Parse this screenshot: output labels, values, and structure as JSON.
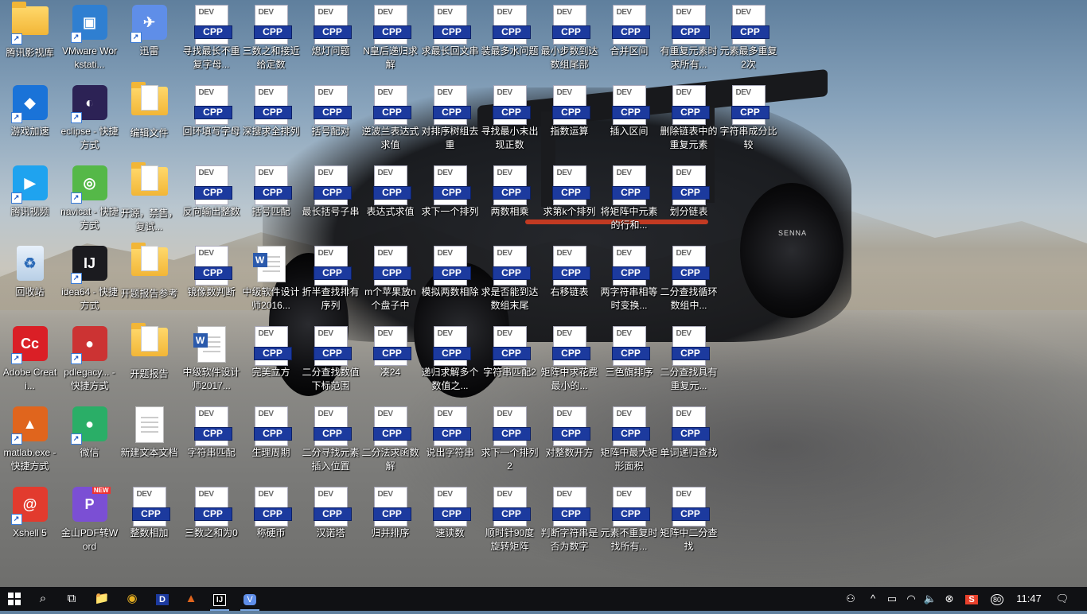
{
  "icons": [
    {
      "label": "腾讯影视库",
      "type": "folder-app",
      "color": "#f2b637",
      "shortcut": true
    },
    {
      "label": "VMware Workstati...",
      "type": "app",
      "color": "#2f7fd1",
      "shortcut": true,
      "glyph": "▣"
    },
    {
      "label": "迅雷",
      "type": "app",
      "color": "#5f8ee8",
      "shortcut": true,
      "glyph": "✈"
    },
    {
      "label": "寻找最长不重复字母...",
      "type": "dev"
    },
    {
      "label": "三数之和接近给定数",
      "type": "dev"
    },
    {
      "label": "熄灯问题",
      "type": "dev"
    },
    {
      "label": "N皇后递归求解",
      "type": "dev"
    },
    {
      "label": "求最长回文串",
      "type": "dev"
    },
    {
      "label": "装最多水问题",
      "type": "dev"
    },
    {
      "label": "最小步数到达数组尾部",
      "type": "dev"
    },
    {
      "label": "合并区间",
      "type": "dev"
    },
    {
      "label": "有重复元素时求所有...",
      "type": "dev"
    },
    {
      "label": "元素最多重复2次",
      "type": "dev"
    },
    {
      "label": "游戏加速",
      "type": "app",
      "color": "#1a73d8",
      "shortcut": true,
      "glyph": "◆"
    },
    {
      "label": "eclipse - 快捷方式",
      "type": "app",
      "color": "#2c2255",
      "shortcut": true,
      "glyph": "◐"
    },
    {
      "label": "编辑文件",
      "type": "folder"
    },
    {
      "label": "回环填写字母",
      "type": "dev"
    },
    {
      "label": "深搜求全排列",
      "type": "dev"
    },
    {
      "label": "括号配对",
      "type": "dev"
    },
    {
      "label": "逆波兰表达式求值",
      "type": "dev"
    },
    {
      "label": "对排序树组去重",
      "type": "dev"
    },
    {
      "label": "寻找最小未出现正数",
      "type": "dev"
    },
    {
      "label": "指数运算",
      "type": "dev"
    },
    {
      "label": "插入区间",
      "type": "dev"
    },
    {
      "label": "删除链表中的重复元素",
      "type": "dev"
    },
    {
      "label": "字符串成分比较",
      "type": "dev"
    },
    {
      "label": "腾讯视频",
      "type": "app",
      "color": "#1fa3ef",
      "shortcut": true,
      "glyph": "▶"
    },
    {
      "label": "navicat - 快捷方式",
      "type": "app",
      "color": "#55b848",
      "shortcut": true,
      "glyph": "◎"
    },
    {
      "label": "开源，禁售，复试...",
      "type": "folder"
    },
    {
      "label": "反向输出整数",
      "type": "dev"
    },
    {
      "label": "括号匹配",
      "type": "dev"
    },
    {
      "label": "最长括号子串",
      "type": "dev"
    },
    {
      "label": "表达式求值",
      "type": "dev"
    },
    {
      "label": "求下一个排列",
      "type": "dev"
    },
    {
      "label": "两数相乘",
      "type": "dev"
    },
    {
      "label": "求第k个排列",
      "type": "dev"
    },
    {
      "label": "将矩阵中元素的行和...",
      "type": "dev"
    },
    {
      "label": "划分链表",
      "type": "dev"
    },
    {
      "label": "回收站",
      "type": "recycle"
    },
    {
      "label": "idea64 - 快捷方式",
      "type": "app",
      "color": "#1b1b1f",
      "shortcut": true,
      "glyph": "IJ"
    },
    {
      "label": "开题报告参考",
      "type": "folder"
    },
    {
      "label": "镜像数判断",
      "type": "dev"
    },
    {
      "label": "中级软件设计师2016...",
      "type": "word"
    },
    {
      "label": "折半查找排有序列",
      "type": "dev"
    },
    {
      "label": "m个苹果放n个盘子中",
      "type": "dev"
    },
    {
      "label": "模拟两数相除",
      "type": "dev"
    },
    {
      "label": "求是否能到达数组末尾",
      "type": "dev"
    },
    {
      "label": "右移链表",
      "type": "dev"
    },
    {
      "label": "两字符串相等时变换...",
      "type": "dev"
    },
    {
      "label": "二分查找循环数组中...",
      "type": "dev"
    },
    {
      "label": "Adobe Creati...",
      "type": "app",
      "color": "#da1f26",
      "shortcut": true,
      "glyph": "Cc"
    },
    {
      "label": "pdlegacy... - 快捷方式",
      "type": "app",
      "color": "#c33",
      "shortcut": true,
      "glyph": "●"
    },
    {
      "label": "开题报告",
      "type": "folder"
    },
    {
      "label": "中级软件设计师2017...",
      "type": "word"
    },
    {
      "label": "完美立方",
      "type": "dev"
    },
    {
      "label": "二分查找数值下标范围",
      "type": "dev"
    },
    {
      "label": "凑24",
      "type": "dev"
    },
    {
      "label": "递归求解多个数值之...",
      "type": "dev"
    },
    {
      "label": "字符串匹配2",
      "type": "dev"
    },
    {
      "label": "矩阵中求花费最小的...",
      "type": "dev"
    },
    {
      "label": "三色旗排序",
      "type": "dev"
    },
    {
      "label": "二分查找具有重复元...",
      "type": "dev"
    },
    {
      "label": "matlab.exe - 快捷方式",
      "type": "app",
      "color": "#e0651d",
      "shortcut": true,
      "glyph": "▲"
    },
    {
      "label": "微信",
      "type": "app",
      "color": "#2aae67",
      "shortcut": true,
      "glyph": "●"
    },
    {
      "label": "新建文本文档",
      "type": "text"
    },
    {
      "label": "字符串匹配",
      "type": "dev"
    },
    {
      "label": "生理周期",
      "type": "dev"
    },
    {
      "label": "二分寻找元素插入位置",
      "type": "dev"
    },
    {
      "label": "二分法求函数解",
      "type": "dev"
    },
    {
      "label": "说出字符串",
      "type": "dev"
    },
    {
      "label": "求下一个排列2",
      "type": "dev"
    },
    {
      "label": "对整数开方",
      "type": "dev"
    },
    {
      "label": "矩阵中最大矩形面积",
      "type": "dev"
    },
    {
      "label": "单词递归查找",
      "type": "dev"
    },
    {
      "label": "Xshell 5",
      "type": "app",
      "color": "#e23b2e",
      "shortcut": true,
      "glyph": "@"
    },
    {
      "label": "金山PDF转Word",
      "type": "app",
      "color": "#7b4fd4",
      "shortcut": false,
      "glyph": "P"
    },
    {
      "label": "整数相加",
      "type": "dev"
    },
    {
      "label": "三数之和为0",
      "type": "dev"
    },
    {
      "label": "称硬币",
      "type": "dev"
    },
    {
      "label": "汉诺塔",
      "type": "dev"
    },
    {
      "label": "归并排序",
      "type": "dev"
    },
    {
      "label": "速读数",
      "type": "dev"
    },
    {
      "label": "顺时针90度旋转矩阵",
      "type": "dev"
    },
    {
      "label": "判断字符串是否为数字",
      "type": "dev"
    },
    {
      "label": "元素不重复时找所有...",
      "type": "dev"
    },
    {
      "label": "矩阵中二分查找",
      "type": "dev"
    }
  ],
  "dev_icon": {
    "top": "DEV",
    "badge": "CPP"
  },
  "word_badge": "W",
  "shortcut_glyph": "↗",
  "new_badge": "NEW",
  "car_brand": "SENNA",
  "taskbar": {
    "start_icon": "windows-logo",
    "search_glyph": "⌕",
    "taskview_glyph": "⧉",
    "explorer_glyph": "📁",
    "chrome_glyph": "◉",
    "devcpp_glyph": "D",
    "chart_glyph": "▲",
    "idea_glyph": "IJ",
    "vm_glyph": "V",
    "tray": {
      "person_glyph": "⚇",
      "chevron_glyph": "^",
      "battery_glyph": "▭",
      "wifi_glyph": "◠",
      "volume_glyph": "🔈",
      "close_glyph": "⊗",
      "sogou_glyph": "S",
      "badge": "80",
      "time": "11:47",
      "notify_glyph": "🗨"
    }
  }
}
